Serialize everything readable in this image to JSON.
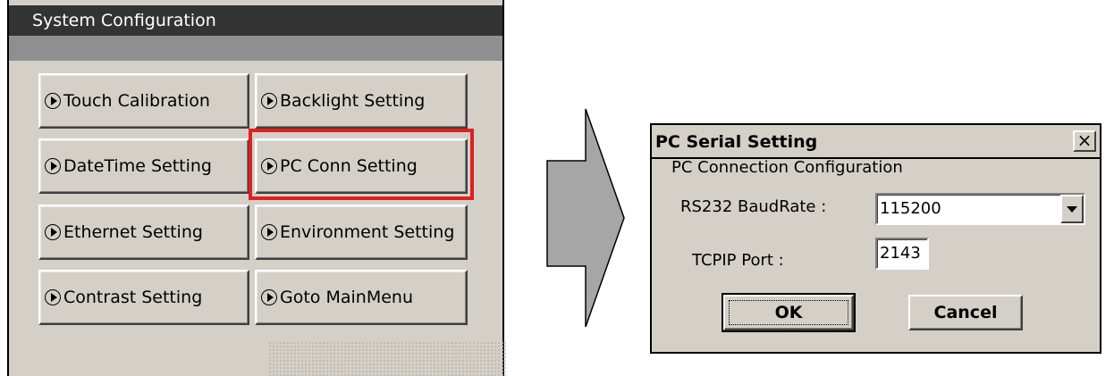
{
  "system_config": {
    "title": "System Configuration",
    "buttons": [
      {
        "label": "Touch Calibration"
      },
      {
        "label": "Backlight Setting"
      },
      {
        "label": "DateTime Setting"
      },
      {
        "label": "PC Conn Setting"
      },
      {
        "label": "Ethernet Setting"
      },
      {
        "label": "Environment Setting"
      },
      {
        "label": "Contrast Setting"
      },
      {
        "label": "Goto MainMenu"
      }
    ],
    "highlight_color": "#e02020"
  },
  "dialog": {
    "title": "PC Serial Setting",
    "close_label": "×",
    "heading": "PC Connection Configuration",
    "baud_label": "RS232 BaudRate :",
    "baud_value": "115200",
    "port_label": "TCPIP Port  :",
    "port_value": "2143",
    "ok_label": "OK",
    "cancel_label": "Cancel"
  },
  "icons": {
    "button_icon": "play-circle-icon",
    "dropdown_icon": "chevron-down-icon",
    "transition_arrow": "right-arrow-icon"
  }
}
